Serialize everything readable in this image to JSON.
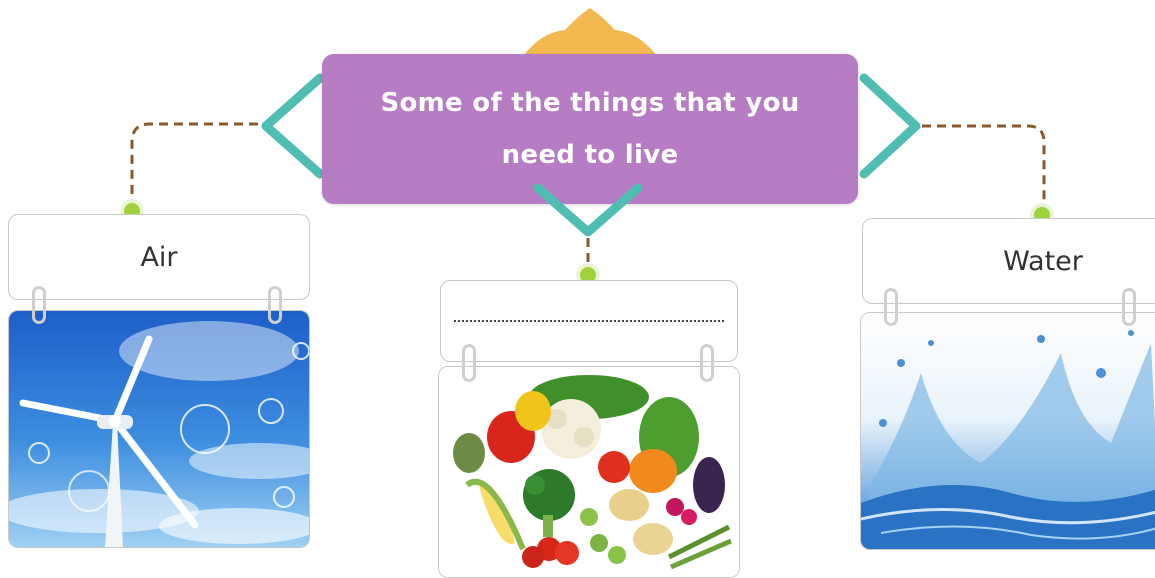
{
  "title": "Some of the things that you need to live",
  "cards": [
    {
      "label": "Air",
      "image": "wind-turbine-sky"
    },
    {
      "label": "",
      "image": "vegetables"
    },
    {
      "label": "Water",
      "image": "water-splash"
    }
  ],
  "colors": {
    "banner": "#b67cc4",
    "banner_top": "#f4b850",
    "chevron": "#4fbdb2",
    "connector": "#8a5a2a",
    "dot": "#9fd23c"
  }
}
